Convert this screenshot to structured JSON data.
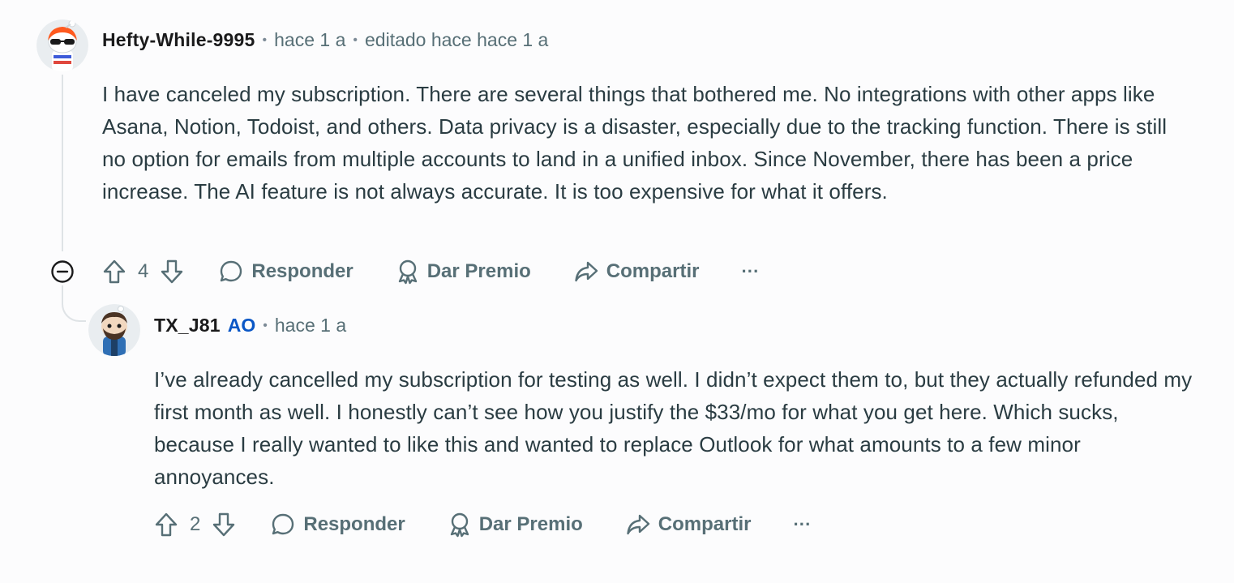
{
  "comments": [
    {
      "username": "Hefty-While-9995",
      "time": "hace 1 a",
      "edited": "editado hace hace 1 a",
      "body": "I have canceled my subscription. There are several things that bothered me. No integrations with other apps like Asana, Notion, Todoist, and others. Data privacy is a disaster, especially due to the tracking function. There is still no option for emails from multiple accounts to land in a unified inbox. Since November, there has been a price increase. The AI feature is not always accurate. It is too expensive for what it offers.",
      "votes": "4",
      "reply_label": "Responder",
      "award_label": "Dar Premio",
      "share_label": "Compartir",
      "more_label": "···"
    },
    {
      "username": "TX_J81",
      "op_badge": "AO",
      "time": "hace 1 a",
      "body": "I’ve already cancelled my subscription for testing as well. I didn’t expect them to, but they actually refunded my first month as well. I honestly can’t see how you justify the $33/mo for what you get here. Which sucks, because I really wanted to like this and wanted to replace Outlook for what amounts to a few minor annoyances.",
      "votes": "2",
      "reply_label": "Responder",
      "award_label": "Dar Premio",
      "share_label": "Compartir",
      "more_label": "···"
    }
  ],
  "colors": {
    "background": "#fcfcfd",
    "text": "#2a3c42",
    "meta": "#576f76",
    "op_badge": "#0a57c6",
    "thread_line": "#dfe3e6"
  },
  "icons": [
    "upvote-icon",
    "downvote-icon",
    "comment-bubble-icon",
    "award-icon",
    "share-arrow-icon",
    "collapse-minus-icon",
    "more-dots-icon"
  ]
}
